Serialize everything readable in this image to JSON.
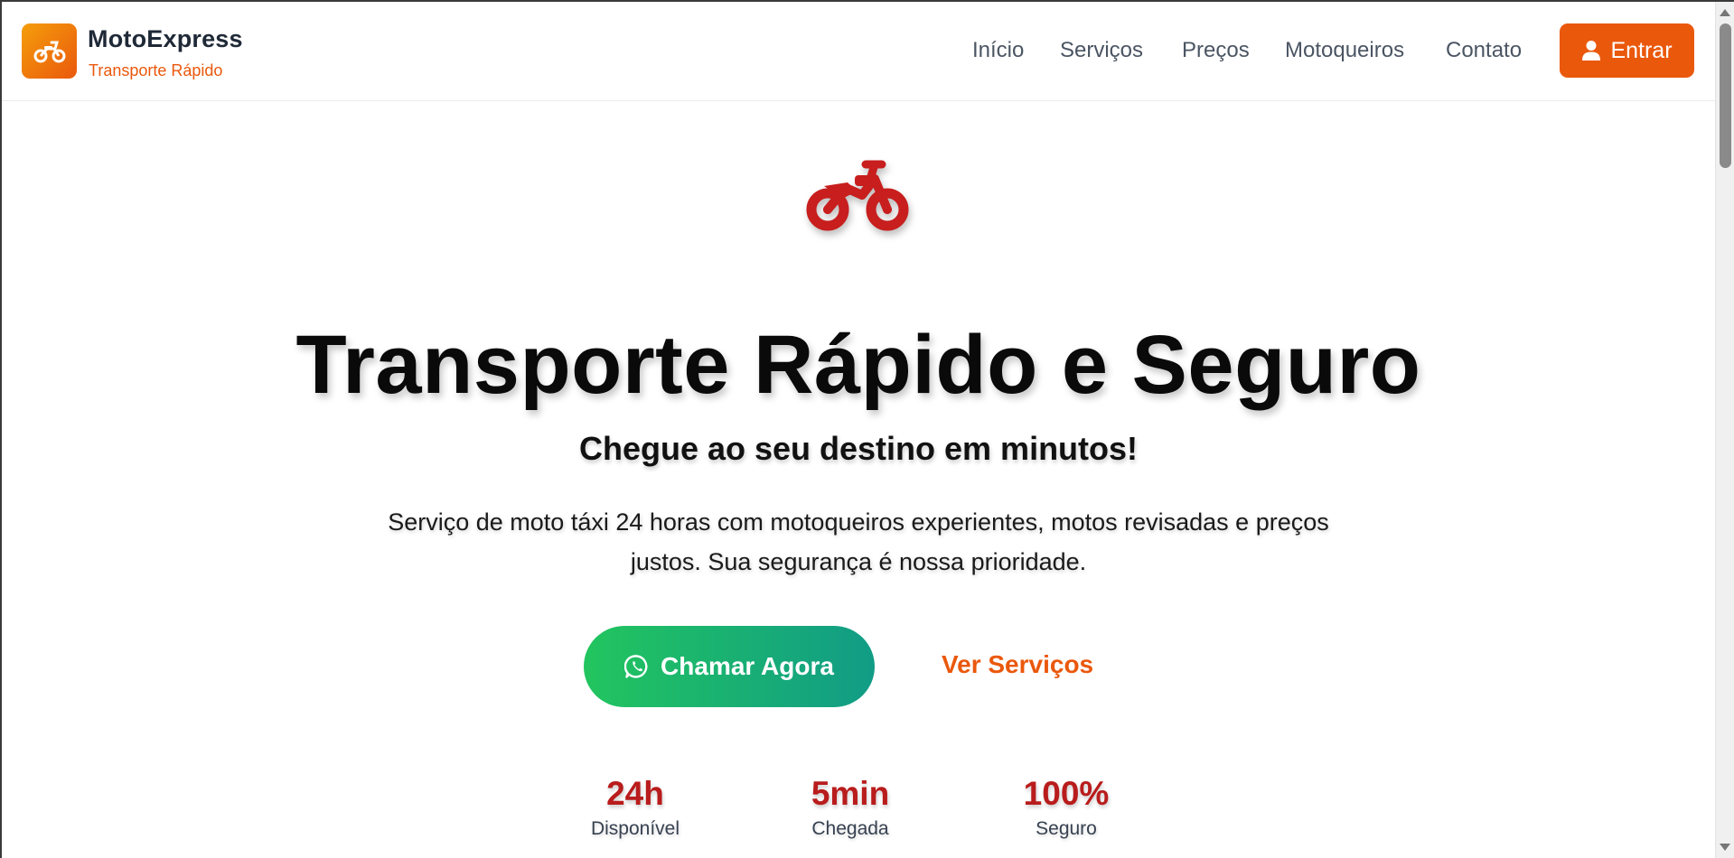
{
  "brand": {
    "name": "MotoExpress",
    "tagline": "Transporte Rápido",
    "logo_icon": "motorcycle-icon"
  },
  "nav": {
    "items": [
      {
        "label": "Início"
      },
      {
        "label": "Serviços"
      },
      {
        "label": "Preços"
      },
      {
        "label": "Motoqueiros"
      },
      {
        "label": "Contato"
      }
    ],
    "login_label": "Entrar",
    "login_icon": "user-icon"
  },
  "hero": {
    "icon": "motorcycle-icon",
    "title": "Transporte Rápido e Seguro",
    "subtitle": "Chegue ao seu destino em minutos!",
    "description": "Serviço de moto táxi 24 horas com motoqueiros experientes, motos revisadas e preços justos. Sua segurança é nossa prioridade.",
    "cta_label": "Chamar Agora",
    "cta_icon": "whatsapp-icon",
    "secondary_label": "Ver Serviços"
  },
  "stats": [
    {
      "value": "24h",
      "label": "Disponível"
    },
    {
      "value": "5min",
      "label": "Chegada"
    },
    {
      "value": "100%",
      "label": "Seguro"
    }
  ],
  "colors": {
    "accent": "#ea580c",
    "logo_gradient_start": "#f59e0b",
    "hero_icon": "#c81e1e",
    "stat_value": "#b91c1c",
    "cta_gradient_start": "#22c55e",
    "cta_gradient_end": "#119c86"
  }
}
